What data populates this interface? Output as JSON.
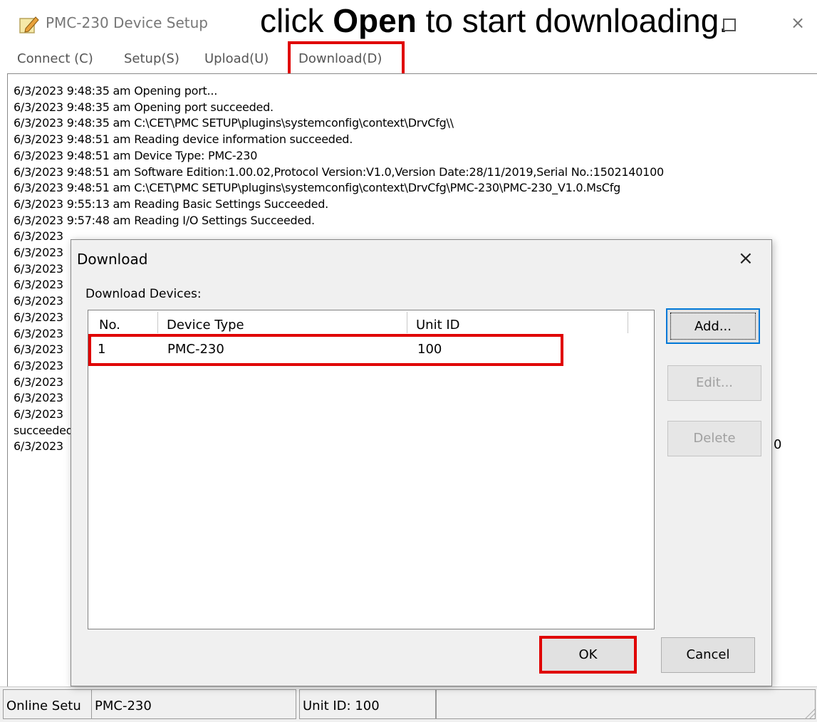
{
  "window": {
    "title": "PMC-230 Device Setup",
    "instruction_prefix": "click ",
    "instruction_bold": "Open",
    "instruction_suffix": " to start downloading.",
    "close_glyph": "×"
  },
  "menu": [
    {
      "label": "Connect (C)"
    },
    {
      "label": "Setup(S)"
    },
    {
      "label": "Upload(U)"
    },
    {
      "label": "Download(D)",
      "highlighted": true
    }
  ],
  "log": {
    "lines": [
      "6/3/2023 9:48:35 am  Opening port...",
      "6/3/2023 9:48:35 am  Opening port succeeded.",
      "6/3/2023 9:48:35 am  C:\\CET\\PMC SETUP\\plugins\\systemconfig\\context\\DrvCfg\\\\",
      "6/3/2023 9:48:51 am  Reading device information succeeded.",
      "6/3/2023 9:48:51 am  Device Type: PMC-230",
      "6/3/2023 9:48:51 am  Software Edition:1.00.02,Protocol Version:V1.0,Version Date:28/11/2019,Serial No.:1502140100",
      "6/3/2023 9:48:51 am  C:\\CET\\PMC SETUP\\plugins\\systemconfig\\context\\DrvCfg\\PMC-230\\PMC-230_V1.0.MsCfg",
      "6/3/2023 9:55:13 am  Reading Basic Settings Succeeded.",
      "6/3/2023 9:57:48 am  Reading I/O Settings Succeeded.",
      "6/3/2023",
      "6/3/2023",
      "6/3/2023",
      "6/3/2023",
      "6/3/2023",
      "6/3/2023",
      "6/3/2023",
      "6/3/2023",
      "6/3/2023",
      "6/3/2023",
      "6/3/2023",
      "6/3/2023",
      "succeeded",
      "6/3/2023"
    ],
    "right_fragment": "0"
  },
  "dialog": {
    "title": "Download",
    "close_glyph": "×",
    "devices_label": "Download Devices:",
    "columns": [
      "No.",
      "Device Type",
      "Unit ID"
    ],
    "rows": [
      {
        "no": "1",
        "device_type": "PMC-230",
        "unit_id": "100"
      }
    ],
    "buttons": {
      "add": "Add...",
      "edit": "Edit...",
      "delete": "Delete",
      "ok": "OK",
      "cancel": "Cancel"
    }
  },
  "status": {
    "mode": "Online Setu",
    "device": "PMC-230",
    "unit": "Unit ID: 100"
  },
  "colors": {
    "highlight": "#e00000",
    "focus_border": "#0078d7"
  }
}
